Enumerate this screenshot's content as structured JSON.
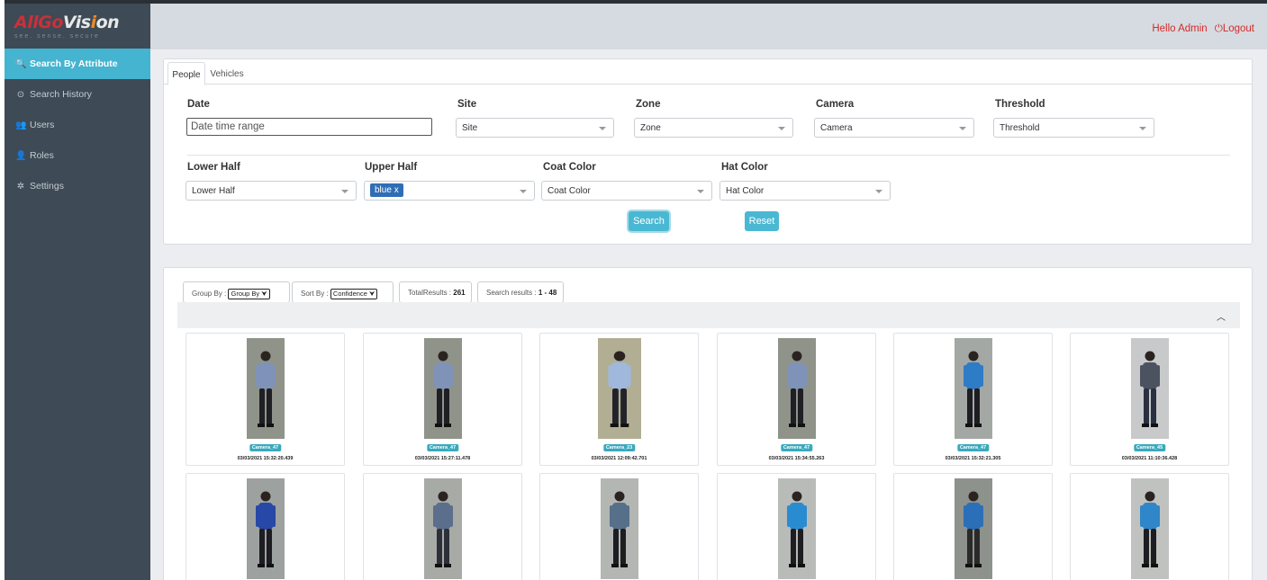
{
  "logo": {
    "main_a": "AllGo",
    "main_b": "Vis",
    "main_c": "i",
    "main_d": "on",
    "tagline": "see. sense. secure"
  },
  "sidebar": {
    "items": [
      {
        "label": "Search By Attribute",
        "icon": "search-icon",
        "glyph": "🔍",
        "active": true
      },
      {
        "label": "Search History",
        "icon": "history-icon",
        "glyph": "⊙"
      },
      {
        "label": "Users",
        "icon": "users-icon",
        "glyph": "👥"
      },
      {
        "label": "Roles",
        "icon": "roles-icon",
        "glyph": "👤"
      },
      {
        "label": "Settings",
        "icon": "gear-icon",
        "glyph": "✲"
      }
    ]
  },
  "header": {
    "greeting": "Hello Admin",
    "logout_glyph": "⏻",
    "logout": "Logout",
    "accent": "#d32a2a"
  },
  "tabs": [
    "People",
    "Vehicles"
  ],
  "filters": {
    "date_label": "Date",
    "date_placeholder": "Date time range",
    "site_label": "Site",
    "site_value": "Site",
    "zone_label": "Zone",
    "zone_value": "Zone",
    "camera_label": "Camera",
    "camera_value": "Camera",
    "threshold_label": "Threshold",
    "threshold_value": "Threshold",
    "lower_label": "Lower Half",
    "lower_value": "Lower Half",
    "upper_label": "Upper Half",
    "upper_chip": "blue",
    "upper_chip_remove": "x",
    "coat_label": "Coat Color",
    "coat_value": "Coat Color",
    "hat_label": "Hat Color",
    "hat_value": "Hat Color"
  },
  "actions": {
    "search": "Search",
    "reset": "Reset",
    "accent": "#4ab8d3"
  },
  "results_bar": {
    "group_by_label": "Group By :",
    "group_by_value": "Group By",
    "sort_by_label": "Sort By :",
    "sort_by_value": "Confidence",
    "total_label": "TotalResults :",
    "total_value": "261",
    "range_label": "Search results :",
    "range_value": "1 - 48"
  },
  "results": [
    {
      "camera": "Camera_47",
      "time": "03/03/2021 15:32:20.439",
      "shirt": "#7f93b8",
      "pants": "#1f1f24",
      "bg": "#8f9389"
    },
    {
      "camera": "Camera_47",
      "time": "03/03/2021 15:27:11.478",
      "shirt": "#7f93b8",
      "pants": "#1f1f24",
      "bg": "#8f9389"
    },
    {
      "camera": "Camera_23",
      "time": "03/03/2021 12:09:42.701",
      "shirt": "#9fb8dc",
      "pants": "#22232a",
      "bg": "#b2ae94"
    },
    {
      "camera": "Camera_47",
      "time": "03/03/2021 15:34:55.263",
      "shirt": "#7f93b8",
      "pants": "#1f1f24",
      "bg": "#8f9389"
    },
    {
      "camera": "Camera_47",
      "time": "03/03/2021 15:32:21.305",
      "shirt": "#2e7bc6",
      "pants": "#1d1d22",
      "bg": "#a4a8a4"
    },
    {
      "camera": "Camera_45",
      "time": "03/03/2021 11:10:36.428",
      "shirt": "#4b5260",
      "pants": "#2b3040",
      "bg": "#c7c9cb"
    },
    {
      "camera": "",
      "time": "",
      "shirt": "#2848a8",
      "pants": "#1d1d22",
      "bg": "#9da2a0"
    },
    {
      "camera": "",
      "time": "",
      "shirt": "#5b6f8c",
      "pants": "#2c3038",
      "bg": "#a8aaa6"
    },
    {
      "camera": "",
      "time": "",
      "shirt": "#56708a",
      "pants": "#1d1d22",
      "bg": "#b4b6b3"
    },
    {
      "camera": "",
      "time": "",
      "shirt": "#2a8cd0",
      "pants": "#1d1d22",
      "bg": "#b9bbb8"
    },
    {
      "camera": "",
      "time": "",
      "shirt": "#2a6fb8",
      "pants": "#2a2a2a",
      "bg": "#8e928c"
    },
    {
      "camera": "",
      "time": "",
      "shirt": "#2f86c9",
      "pants": "#1d1d22",
      "bg": "#c0c2bf"
    }
  ]
}
